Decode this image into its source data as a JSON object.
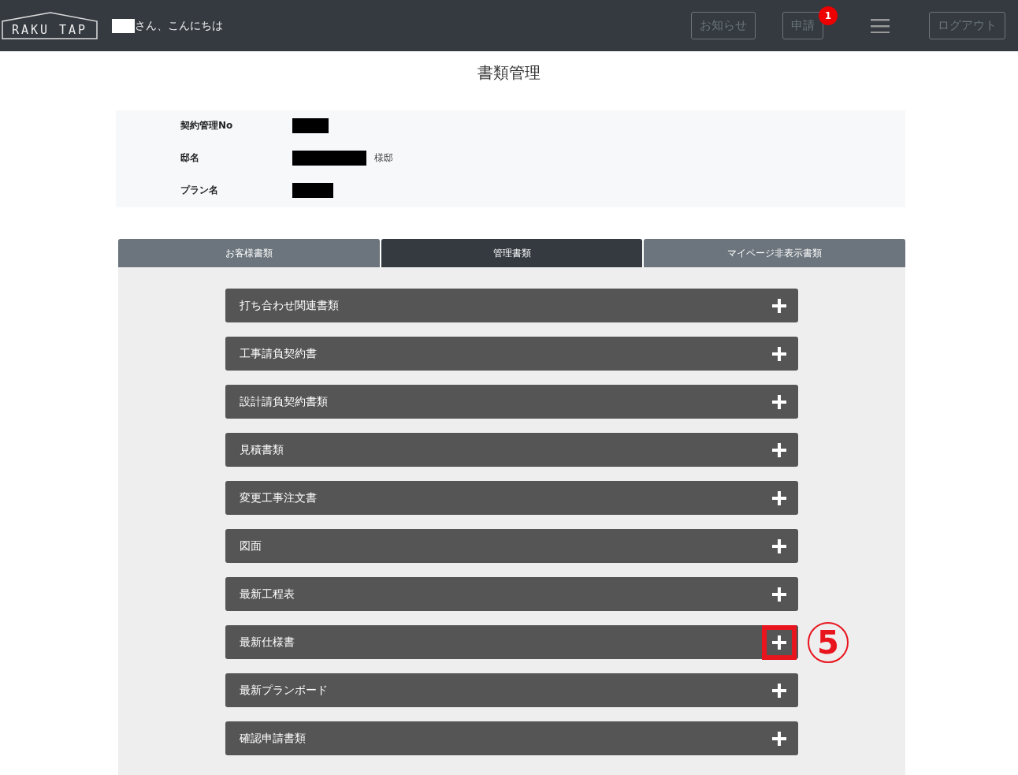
{
  "header": {
    "logo": "RAKU TAP",
    "greeting": "さん、こんにちは",
    "buttons": [
      {
        "label": "お知らせ"
      },
      {
        "label": "申請",
        "badge": "1"
      }
    ],
    "logout": "ログアウト"
  },
  "title": "書類管理",
  "info": [
    {
      "label": "契約管理No"
    },
    {
      "label": "邸名",
      "suffix": "様邸"
    },
    {
      "label": "プラン名"
    }
  ],
  "tabs": [
    {
      "label": "お客様書類",
      "selected": false
    },
    {
      "label": "管理書類",
      "selected": true
    },
    {
      "label": "マイページ非表示書類",
      "selected": false
    }
  ],
  "sections": [
    {
      "label": "打ち合わせ関連書類",
      "highlighted": false
    },
    {
      "label": "工事請負契約書",
      "highlighted": false
    },
    {
      "label": "設計請負契約書類",
      "highlighted": false
    },
    {
      "label": "見積書類",
      "highlighted": false
    },
    {
      "label": "変更工事注文書",
      "highlighted": false
    },
    {
      "label": "図面",
      "highlighted": false
    },
    {
      "label": "最新工程表",
      "highlighted": false
    },
    {
      "label": "最新仕様書",
      "highlighted": true,
      "callout": "5"
    },
    {
      "label": "最新プランボード",
      "highlighted": false
    },
    {
      "label": "確認申請書類",
      "highlighted": false
    }
  ]
}
